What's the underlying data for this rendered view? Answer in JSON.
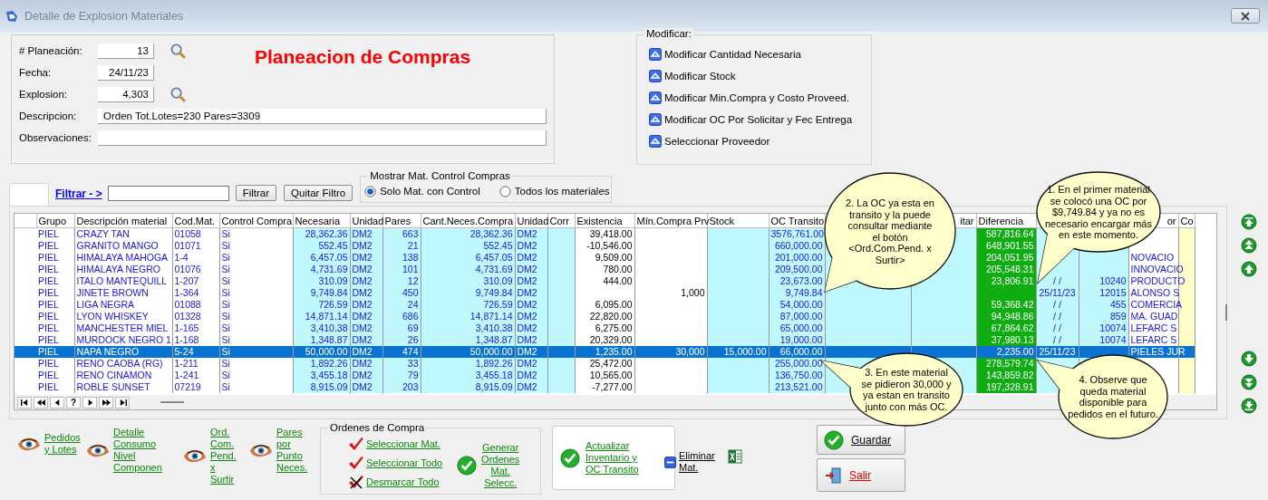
{
  "window": {
    "title": "Detalle de Explosion Materiales"
  },
  "header": {
    "title": "Planeacion de Compras",
    "fields": [
      {
        "label": "# Planeación:",
        "value": "13",
        "kind": "short",
        "search": true
      },
      {
        "label": "Fecha:",
        "value": "24/11/23",
        "kind": "short",
        "search": false
      },
      {
        "label": "Explosion:",
        "value": "4,303",
        "kind": "short",
        "search": true
      },
      {
        "label": "Descripcion:",
        "value": "Orden  Tot.Lotes=230 Pares=3309",
        "kind": "long",
        "search": false
      },
      {
        "label": "Observaciones:",
        "kind": "long",
        "search": false
      }
    ]
  },
  "modify": {
    "title": "Modificar:",
    "items": [
      "Modificar Cantidad Necesaria",
      "Modificar Stock",
      "Modificar Min.Compra y Costo Proveed.",
      "Modificar OC Por Solicitar y Fec Entrega",
      "Seleccionar Proveedor"
    ]
  },
  "filter": {
    "link": "Filtrar - >",
    "buttons": [
      "Filtrar",
      "Quitar Filtro"
    ],
    "group_title": "Mostrar Mat. Control Compras",
    "options": [
      {
        "label": "Solo Mat. con Control",
        "selected": true
      },
      {
        "label": "Todos los materiales",
        "selected": false
      }
    ]
  },
  "table": {
    "columns": [
      {
        "header": "Grupo"
      },
      {
        "header": "Descripción material"
      },
      {
        "header": "Cod.Mat."
      },
      {
        "header": "Control Compra"
      },
      {
        "header": "Necesaria"
      },
      {
        "header": "Unidad"
      },
      {
        "header": "Pares"
      },
      {
        "header": "Cant.Neces.Compra"
      },
      {
        "header": "Unidad"
      },
      {
        "header": "Corr"
      },
      {
        "header": "Existencia"
      },
      {
        "header": "Mín.Compra Prv"
      },
      {
        "header": "Stock"
      },
      {
        "header": "OC Transito"
      },
      {},
      {
        "header": "itar"
      },
      {
        "header": "Diferencia"
      },
      {},
      {},
      {
        "header": "or"
      },
      {
        "header": "Co"
      }
    ],
    "rows": [
      {
        "selected": false,
        "cells": [
          "PIEL",
          "CRAZY TAN",
          "01058",
          "Si",
          "28,362.36",
          "DM2",
          "663",
          "28,362.36",
          "DM2",
          null,
          "39,418.00",
          null,
          null,
          "3576,761.00",
          null,
          null,
          "587,816.64",
          null,
          null,
          null,
          null
        ]
      },
      {
        "selected": false,
        "cells": [
          "PIEL",
          "GRANITO MANGO",
          "01071",
          "Si",
          "552.45",
          "DM2",
          "21",
          "552.45",
          "DM2",
          null,
          "-10,546.00",
          null,
          null,
          "660,000.00",
          null,
          null,
          "648,901.55",
          null,
          null,
          null,
          null
        ]
      },
      {
        "selected": false,
        "cells": [
          "PIEL",
          "HIMALAYA MAHOGA",
          "1-4",
          "Si",
          "6,457.05",
          "DM2",
          "138",
          "6,457.05",
          "DM2",
          null,
          "9,509.00",
          null,
          null,
          "201,000.00",
          null,
          null,
          "204,051.95",
          null,
          null,
          "NOVACIO",
          null
        ]
      },
      {
        "selected": false,
        "cells": [
          "PIEL",
          "HIMALAYA NEGRO",
          "01076",
          "Si",
          "4,731.69",
          "DM2",
          "101",
          "4,731.69",
          "DM2",
          null,
          "780.00",
          null,
          null,
          "209,500.00",
          null,
          null,
          "205,548.31",
          null,
          null,
          "INNOVACIO",
          null
        ]
      },
      {
        "selected": false,
        "cells": [
          "PIEL",
          "ITALO MANTEQUILL",
          "1-207",
          "Si",
          "310.09",
          "DM2",
          "12",
          "310.09",
          "DM2",
          null,
          "444.00",
          null,
          null,
          "23,673.00",
          null,
          null,
          "23,806.91",
          "/  /",
          "10240",
          "PRODUCTO",
          null
        ]
      },
      {
        "selected": false,
        "cells": [
          "PIEL",
          "JINETE BROWN",
          "1-364",
          "Si",
          "9,749.84",
          "DM2",
          "450",
          "9,749.84",
          "DM2",
          null,
          null,
          "1,000",
          null,
          "9,749.84",
          null,
          null,
          null,
          "25/11/23",
          "12015",
          "ALONSO S",
          null
        ]
      },
      {
        "selected": false,
        "cells": [
          "PIEL",
          "LIGA NEGRA",
          "01088",
          "Si",
          "726.59",
          "DM2",
          "24",
          "726.59",
          "DM2",
          null,
          "6,095.00",
          null,
          null,
          "54,000.00",
          null,
          null,
          "59,368.42",
          "/  /",
          "455",
          "COMERCIA",
          null
        ]
      },
      {
        "selected": false,
        "cells": [
          "PIEL",
          "LYON WHISKEY",
          "01328",
          "Si",
          "14,871.14",
          "DM2",
          "686",
          "14,871.14",
          "DM2",
          null,
          "22,820.00",
          null,
          null,
          "87,000.00",
          null,
          null,
          "94,948.86",
          "/  /",
          "859",
          "MA. GUAD",
          null
        ]
      },
      {
        "selected": false,
        "cells": [
          "PIEL",
          "MANCHESTER MIEL",
          "1-165",
          "Si",
          "3,410.38",
          "DM2",
          "69",
          "3,410.38",
          "DM2",
          null,
          "6,275.00",
          null,
          null,
          "65,000.00",
          null,
          null,
          "67,864.62",
          "/  /",
          "10074",
          "LEFARC S",
          null
        ]
      },
      {
        "selected": false,
        "cells": [
          "PIEL",
          "MURDOCK NEGRO 1",
          "1-168",
          "Si",
          "1,348.87",
          "DM2",
          "26",
          "1,348.87",
          "DM2",
          null,
          "20,329.00",
          null,
          null,
          "19,000.00",
          null,
          null,
          "37,980.13",
          "/  /",
          "10074",
          "LEFARC S",
          null
        ]
      },
      {
        "selected": true,
        "cells": [
          "PIEL",
          "NAPA NEGRO",
          "5-24",
          "Si",
          "50,000.00",
          "DM2",
          "474",
          "50,000.00",
          "DM2",
          null,
          "1,235.00",
          "30,000",
          "15,000.00",
          "66,000.00",
          null,
          null,
          "2,235.00",
          "25/11/23",
          null,
          "PIELES JUR",
          null
        ]
      },
      {
        "selected": false,
        "cells": [
          "PIEL",
          "RENO CAOBA (RG)",
          "1-211",
          "Si",
          "1,892.26",
          "DM2",
          "33",
          "1,892.26",
          "DM2",
          null,
          "25,472.00",
          null,
          null,
          "255,000.00",
          null,
          null,
          "278,579.74",
          null,
          null,
          null,
          null
        ]
      },
      {
        "selected": false,
        "cells": [
          "PIEL",
          "RENO CINAMON",
          "1-241",
          "Si",
          "3,455.18",
          "DM2",
          "79",
          "3,455.18",
          "DM2",
          null,
          "10,565.00",
          null,
          null,
          "136,750.00",
          null,
          null,
          "143,859.82",
          null,
          null,
          null,
          null
        ]
      },
      {
        "selected": false,
        "cells": [
          "PIEL",
          "ROBLE SUNSET",
          "07219",
          "Si",
          "8,915.09",
          "DM2",
          "203",
          "8,915.09",
          "DM2",
          null,
          "-7,277.00",
          null,
          null,
          "213,521.00",
          null,
          null,
          "197,328.91",
          null,
          null,
          null,
          null
        ]
      }
    ],
    "nav_buttons": [
      {
        "kind": "first"
      },
      {
        "kind": "prev-page"
      },
      {
        "kind": "prev"
      },
      {
        "kind": "find",
        "label": "?"
      },
      {
        "kind": "next"
      },
      {
        "kind": "next-page"
      },
      {
        "kind": "last"
      }
    ]
  },
  "side_buttons": [
    {
      "kind": "top"
    },
    {
      "kind": "page-up"
    },
    {
      "kind": "up"
    },
    {
      "kind": "down"
    },
    {
      "kind": "page-down"
    },
    {
      "kind": "bottom"
    }
  ],
  "callouts": [
    {
      "text": "2. La OC ya esta en transito y la puede consultar mediante el botón <Ord.Com.Pend. x Surtir>"
    },
    {
      "text": "1. En el primer material se colocó una OC por $9,749.84 y ya no es necesario encargar más en este momento."
    },
    {
      "text": "3. En este material se pidieron 30,000 y ya estan en transito junto con más OC."
    },
    {
      "text": "4. Observe que queda material disponible para pedidos en el futuro."
    }
  ],
  "bottom": {
    "links": [
      "Pedidos y Lotes",
      "Detalle Consumo Nivel Componen",
      "Ord. Com. Pend. x Surtir",
      "Pares por Punto Neces."
    ],
    "orders": {
      "title": "Ordenes de Compra",
      "items": [
        {
          "label": "Seleccionar Mat.",
          "kind": "check"
        },
        {
          "label": "Seleccionar Todo",
          "kind": "check"
        },
        {
          "label": "Desmarcar Todo",
          "kind": "uncheck"
        }
      ],
      "generate": "Generar Ordenes Mat. Selecc."
    },
    "update": "Actualizar Inventario y OC Transito",
    "delete": "Eliminar Mat.",
    "save": "Guardar",
    "exit": "Salir"
  }
}
